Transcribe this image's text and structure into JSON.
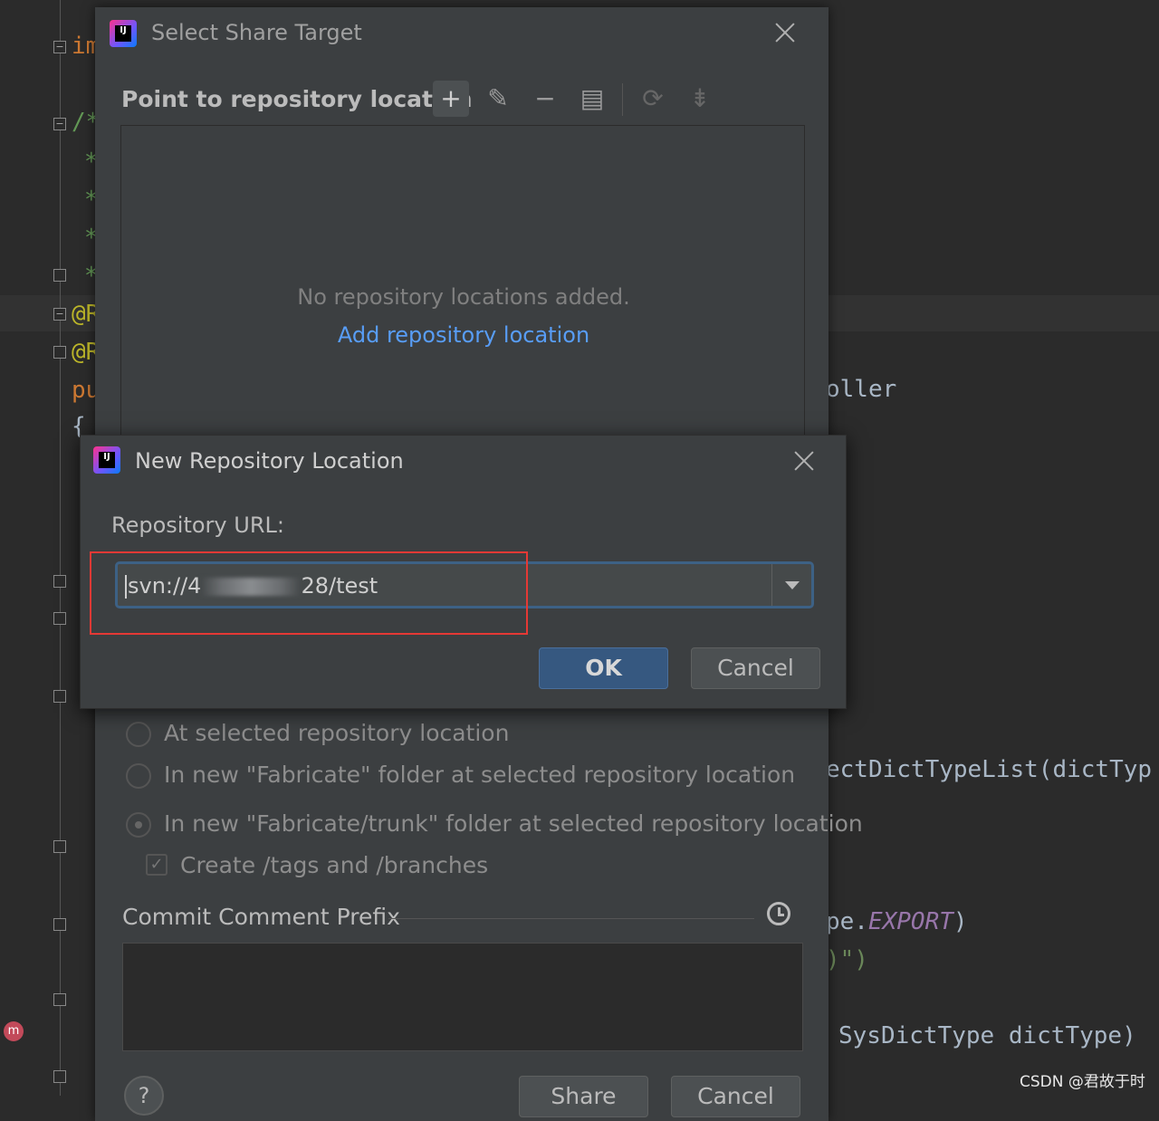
{
  "editor": {
    "code_lines": [
      {
        "text": "im"
      },
      {
        "text": "/*"
      },
      {
        "text": "*"
      },
      {
        "text": "*"
      },
      {
        "text": "*"
      },
      {
        "text": "*"
      },
      {
        "text": "@R"
      },
      {
        "text": "@R"
      },
      {
        "text": "pu"
      },
      {
        "text": "{"
      },
      {
        "text": "oller"
      },
      {
        "text": "ectDictTypeList(dictTyp"
      },
      {
        "text": "pe."
      },
      {
        "text": "EXPORT"
      },
      {
        "text": ")"
      },
      {
        "text": ")\")"
      },
      {
        "text": "SysDictType dictType)"
      }
    ],
    "watermark": "CSDN @君故于时"
  },
  "share_dialog": {
    "title": "Select Share Target",
    "section_title": "Point to repository location",
    "toolbar_icons": [
      "add-icon",
      "edit-icon",
      "remove-icon",
      "copy-icon",
      "refresh-icon",
      "collapse-icon"
    ],
    "empty_text": "No repository locations added.",
    "add_link": "Add repository location",
    "options": [
      "At selected repository location",
      "In new \"Fabricate\" folder at selected repository location",
      "In new \"Fabricate/trunk\" folder at selected repository location"
    ],
    "checkbox_label": "Create /tags and /branches",
    "commit_prefix_label": "Commit Comment Prefix",
    "help_label": "?",
    "share_button": "Share",
    "cancel_button": "Cancel"
  },
  "repo_dialog": {
    "title": "New Repository Location",
    "url_label": "Repository URL:",
    "url_value_start": "svn://4",
    "url_value_end": "28/test",
    "ok_button": "OK",
    "cancel_button": "Cancel"
  },
  "colors": {
    "accent": "#589df6",
    "ok_bg": "#365880",
    "highlight_border": "#e53935",
    "focus_border": "#3d6185"
  }
}
